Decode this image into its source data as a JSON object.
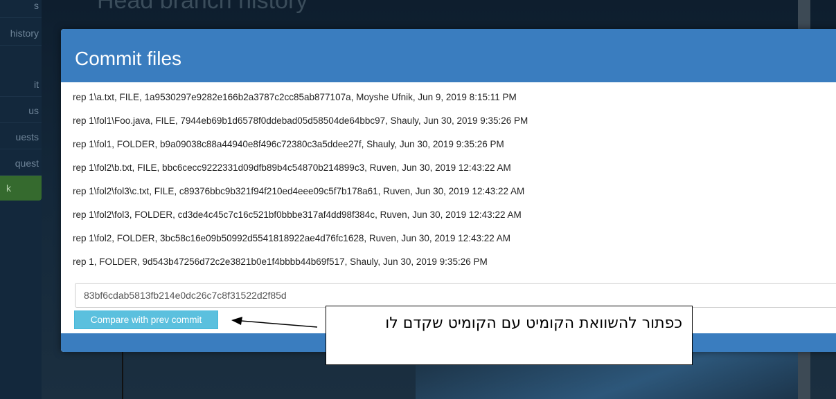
{
  "background": {
    "page_title": "Head branch history",
    "sidebar_items": [
      "s",
      "history",
      "it",
      "us",
      "uests",
      "quest",
      "k"
    ]
  },
  "modal": {
    "title": "Commit files",
    "files": [
      "rep 1\\a.txt, FILE, 1a9530297e9282e166b2a3787c2cc85ab877107a, Moyshe Ufnik, Jun 9, 2019 8:15:11 PM",
      "rep 1\\fol1\\Foo.java, FILE, 7944eb69b1d6578f0ddebad05d58504de64bbc97, Shauly, Jun 30, 2019 9:35:26 PM",
      "rep 1\\fol1, FOLDER, b9a09038c88a44940e8f496c72380c3a5ddee27f, Shauly, Jun 30, 2019 9:35:26 PM",
      "rep 1\\fol2\\b.txt, FILE, bbc6cecc9222331d09dfb89b4c54870b214899c3, Ruven, Jun 30, 2019 12:43:22 AM",
      "rep 1\\fol2\\fol3\\c.txt, FILE, c89376bbc9b321f94f210ed4eee09c5f7b178a61, Ruven, Jun 30, 2019 12:43:22 AM",
      "rep 1\\fol2\\fol3, FOLDER, cd3de4c45c7c16c521bf0bbbe317af4dd98f384c, Ruven, Jun 30, 2019 12:43:22 AM",
      "rep 1\\fol2, FOLDER, 3bc58c16e09b50992d5541818922ae4d76fc1628, Ruven, Jun 30, 2019 12:43:22 AM",
      "rep 1, FOLDER, 9d543b47256d72c2e3821b0e1f4bbbb44b69f517, Shauly, Jun 30, 2019 9:35:26 PM"
    ],
    "commit_sha_value": "83bf6cdab5813fb214e0dc26c7c8f31522d2f85d",
    "compare_button_label": "Compare with prev commit"
  },
  "annotation": {
    "text": "כפתור להשוואת הקומיט עם הקומיט שקדם לו"
  },
  "colors": {
    "header_blue": "#3a7dbf",
    "button_info": "#5bc0de"
  }
}
